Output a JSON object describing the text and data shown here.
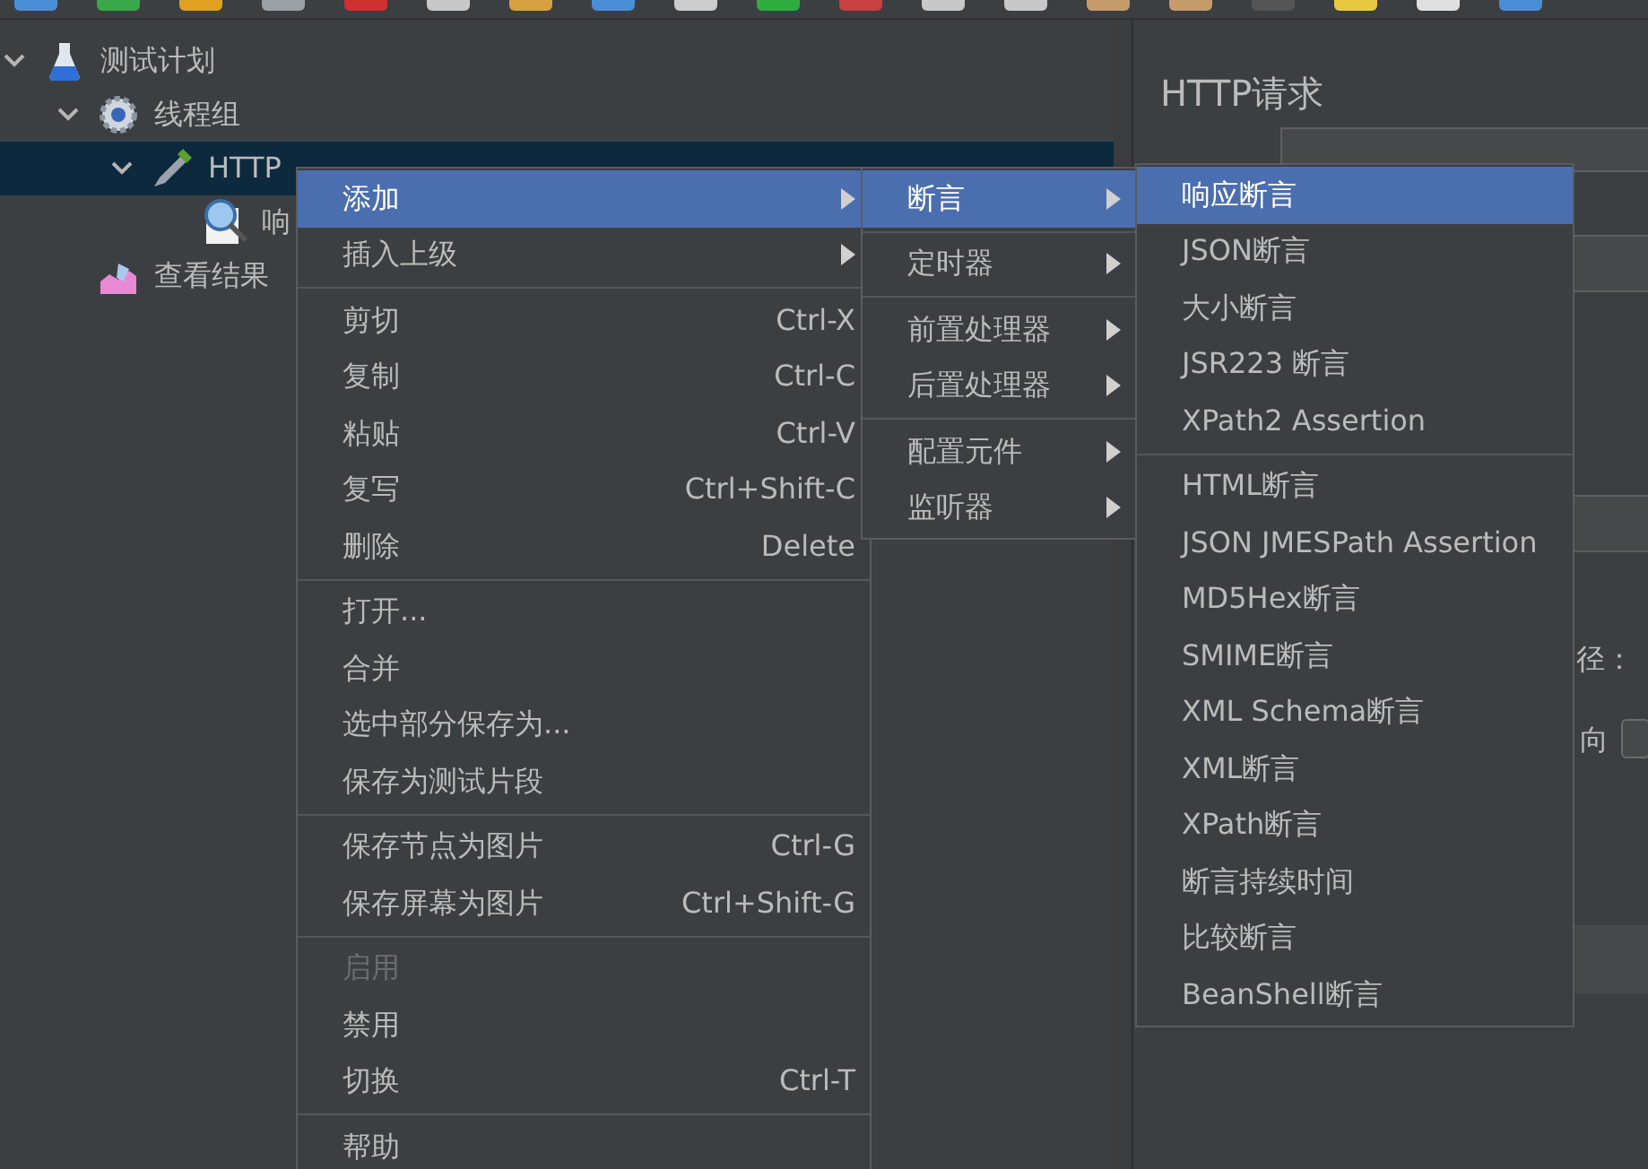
{
  "tree": [
    {
      "label": "测试计划",
      "kind": "test_plan",
      "expanded": true,
      "selected": false,
      "children": [
        {
          "label": "线程组",
          "kind": "thread_group",
          "expanded": true,
          "selected": false,
          "children": [
            {
              "label": "HTTP",
              "kind": "sampler",
              "expanded": true,
              "selected": true,
              "children": [
                {
                  "label": "响",
                  "kind": "assertion",
                  "selected": false
                }
              ]
            }
          ]
        },
        {
          "label": "查看结果",
          "kind": "listener",
          "selected": false
        }
      ]
    }
  ],
  "panel": {
    "title": "HTTP请求",
    "fragments": [
      "径：",
      "向"
    ]
  },
  "context_menu": {
    "items": [
      {
        "kind": "item",
        "label": "添加",
        "has_submenu": true,
        "selected": true,
        "disabled": false
      },
      {
        "kind": "item",
        "label": "插入上级",
        "has_submenu": true,
        "selected": false,
        "disabled": false
      },
      {
        "kind": "separator"
      },
      {
        "kind": "item",
        "label": "剪切",
        "shortcut": "Ctrl-X",
        "has_submenu": false,
        "selected": false,
        "disabled": false
      },
      {
        "kind": "item",
        "label": "复制",
        "shortcut": "Ctrl-C",
        "has_submenu": false,
        "selected": false,
        "disabled": false
      },
      {
        "kind": "item",
        "label": "粘贴",
        "shortcut": "Ctrl-V",
        "has_submenu": false,
        "selected": false,
        "disabled": false
      },
      {
        "kind": "item",
        "label": "复写",
        "shortcut": "Ctrl+Shift-C",
        "has_submenu": false,
        "selected": false,
        "disabled": false
      },
      {
        "kind": "item",
        "label": "删除",
        "shortcut": "Delete",
        "has_submenu": false,
        "selected": false,
        "disabled": false
      },
      {
        "kind": "separator"
      },
      {
        "kind": "item",
        "label": "打开...",
        "has_submenu": false,
        "selected": false,
        "disabled": false
      },
      {
        "kind": "item",
        "label": "合并",
        "has_submenu": false,
        "selected": false,
        "disabled": false
      },
      {
        "kind": "item",
        "label": "选中部分保存为...",
        "has_submenu": false,
        "selected": false,
        "disabled": false
      },
      {
        "kind": "item",
        "label": "保存为测试片段",
        "has_submenu": false,
        "selected": false,
        "disabled": false
      },
      {
        "kind": "separator"
      },
      {
        "kind": "item",
        "label": "保存节点为图片",
        "shortcut": "Ctrl-G",
        "has_submenu": false,
        "selected": false,
        "disabled": false
      },
      {
        "kind": "item",
        "label": "保存屏幕为图片",
        "shortcut": "Ctrl+Shift-G",
        "has_submenu": false,
        "selected": false,
        "disabled": false
      },
      {
        "kind": "separator"
      },
      {
        "kind": "item",
        "label": "启用",
        "has_submenu": false,
        "selected": false,
        "disabled": true
      },
      {
        "kind": "item",
        "label": "禁用",
        "has_submenu": false,
        "selected": false,
        "disabled": false
      },
      {
        "kind": "item",
        "label": "切换",
        "shortcut": "Ctrl-T",
        "has_submenu": false,
        "selected": false,
        "disabled": false
      },
      {
        "kind": "separator"
      },
      {
        "kind": "item",
        "label": "帮助",
        "has_submenu": false,
        "selected": false,
        "disabled": false
      }
    ]
  },
  "add_submenu": {
    "items": [
      {
        "kind": "item",
        "label": "断言",
        "has_submenu": true,
        "selected": true,
        "disabled": false
      },
      {
        "kind": "separator"
      },
      {
        "kind": "item",
        "label": "定时器",
        "has_submenu": true,
        "selected": false,
        "disabled": false
      },
      {
        "kind": "separator"
      },
      {
        "kind": "item",
        "label": "前置处理器",
        "has_submenu": true,
        "selected": false,
        "disabled": false
      },
      {
        "kind": "item",
        "label": "后置处理器",
        "has_submenu": true,
        "selected": false,
        "disabled": false
      },
      {
        "kind": "separator"
      },
      {
        "kind": "item",
        "label": "配置元件",
        "has_submenu": true,
        "selected": false,
        "disabled": false
      },
      {
        "kind": "item",
        "label": "监听器",
        "has_submenu": true,
        "selected": false,
        "disabled": false
      }
    ]
  },
  "assertion_submenu": {
    "items": [
      {
        "kind": "item",
        "label": "响应断言",
        "has_submenu": false,
        "selected": true,
        "disabled": false
      },
      {
        "kind": "item",
        "label": "JSON断言",
        "has_submenu": false,
        "selected": false,
        "disabled": false
      },
      {
        "kind": "item",
        "label": "大小断言",
        "has_submenu": false,
        "selected": false,
        "disabled": false
      },
      {
        "kind": "item",
        "label": "JSR223 断言",
        "has_submenu": false,
        "selected": false,
        "disabled": false
      },
      {
        "kind": "item",
        "label": "XPath2 Assertion",
        "has_submenu": false,
        "selected": false,
        "disabled": false
      },
      {
        "kind": "separator"
      },
      {
        "kind": "item",
        "label": "HTML断言",
        "has_submenu": false,
        "selected": false,
        "disabled": false
      },
      {
        "kind": "item",
        "label": "JSON JMESPath Assertion",
        "has_submenu": false,
        "selected": false,
        "disabled": false
      },
      {
        "kind": "item",
        "label": "MD5Hex断言",
        "has_submenu": false,
        "selected": false,
        "disabled": false
      },
      {
        "kind": "item",
        "label": "SMIME断言",
        "has_submenu": false,
        "selected": false,
        "disabled": false
      },
      {
        "kind": "item",
        "label": "XML Schema断言",
        "has_submenu": false,
        "selected": false,
        "disabled": false
      },
      {
        "kind": "item",
        "label": "XML断言",
        "has_submenu": false,
        "selected": false,
        "disabled": false
      },
      {
        "kind": "item",
        "label": "XPath断言",
        "has_submenu": false,
        "selected": false,
        "disabled": false
      },
      {
        "kind": "item",
        "label": "断言持续时间",
        "has_submenu": false,
        "selected": false,
        "disabled": false
      },
      {
        "kind": "item",
        "label": "比较断言",
        "has_submenu": false,
        "selected": false,
        "disabled": false
      },
      {
        "kind": "item",
        "label": "BeanShell断言",
        "has_submenu": false,
        "selected": false,
        "disabled": false
      }
    ]
  }
}
